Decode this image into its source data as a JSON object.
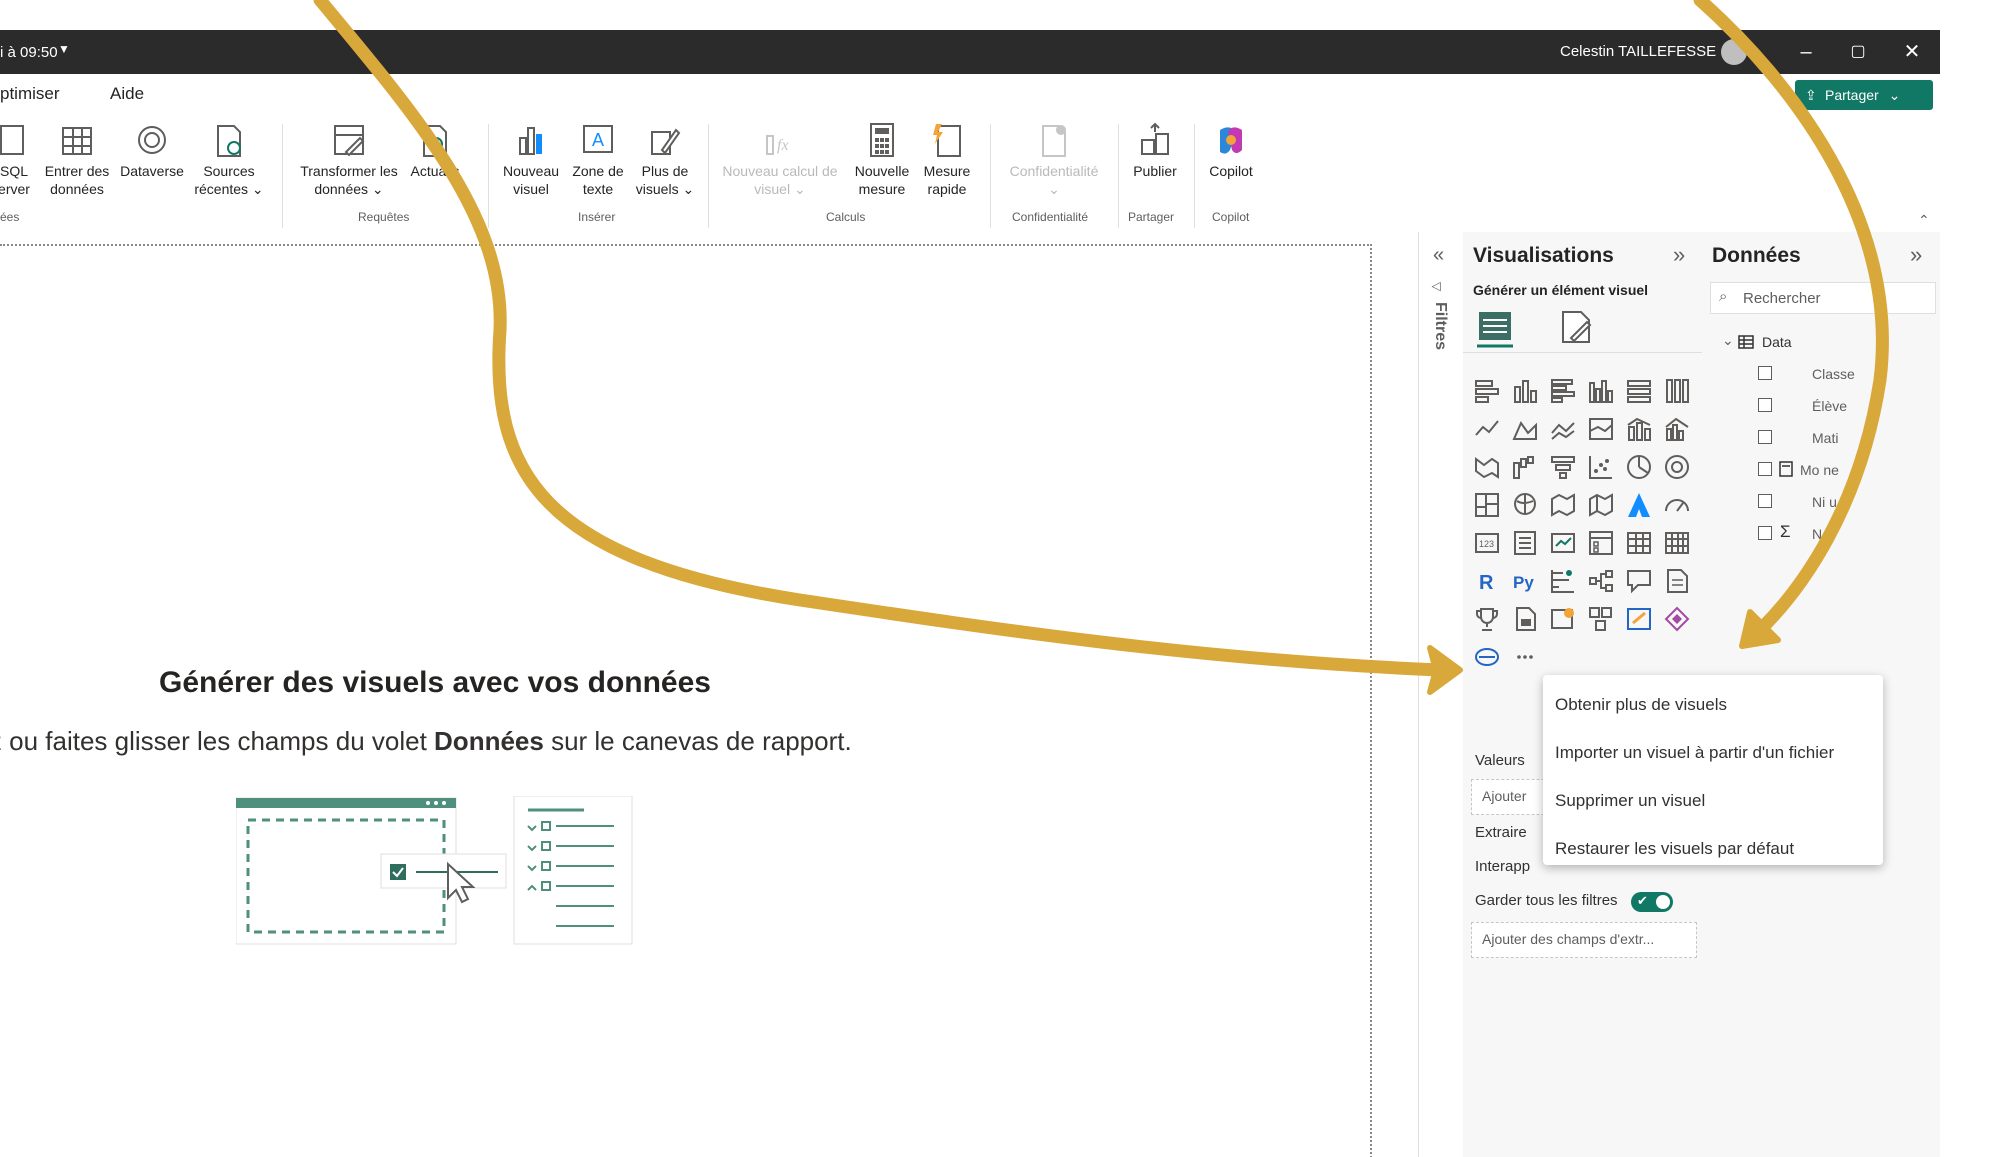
{
  "titlebar": {
    "left_text": "i à 09:50",
    "user_name": "Celestin TAILLEFESSE",
    "minimize": "–",
    "restore": "▢",
    "close": "✕"
  },
  "menubar": {
    "items": [
      "ptimiser",
      "Aide"
    ],
    "share_label": "Partager"
  },
  "ribbon": {
    "buttons": [
      {
        "line1": "SQL",
        "line2": "erver"
      },
      {
        "line1": "Entrer des",
        "line2": "données"
      },
      {
        "line1": "Dataverse",
        "line2": ""
      },
      {
        "line1": "Sources",
        "line2": "récentes ⌄"
      },
      {
        "line1": "Transformer les",
        "line2": "données ⌄"
      },
      {
        "line1": "Actualis",
        "line2": ""
      },
      {
        "line1": "Nouveau",
        "line2": "visuel"
      },
      {
        "line1": "Zone de",
        "line2": "texte"
      },
      {
        "line1": "Plus de",
        "line2": "visuels ⌄"
      },
      {
        "line1": "Nouveau calcul de",
        "line2": "visuel ⌄"
      },
      {
        "line1": "Nouvelle",
        "line2": "mesure"
      },
      {
        "line1": "Mesure",
        "line2": "rapide"
      },
      {
        "line1": "Confidentialité",
        "line2": "⌄"
      },
      {
        "line1": "Publier",
        "line2": ""
      },
      {
        "line1": "Copilot",
        "line2": ""
      }
    ],
    "groups": [
      "ées",
      "Requêtes",
      "Insérer",
      "Calculs",
      "Confidentialité",
      "Partager",
      "Copilot"
    ]
  },
  "canvas": {
    "title": "Générer des visuels avec vos données",
    "subtitle_pre": "nez ou faites glisser les champs du volet ",
    "subtitle_bold": "Données",
    "subtitle_post": " sur le canevas de rapport."
  },
  "filters": {
    "label": "Filtres"
  },
  "visualizations": {
    "title": "Visualisations",
    "subtitle": "Générer un élément visuel",
    "wells": {
      "values_label": "Valeurs",
      "add_placeholder": "Ajouter",
      "extract_label": "Extraire",
      "interact_label": "Interapp",
      "keep_filters_label": "Garder tous les filtres",
      "drill_placeholder": "Ajouter des champs d'extr..."
    }
  },
  "data_pane": {
    "title": "Données",
    "search_placeholder": "Rechercher",
    "table_name": "Data",
    "fields": [
      "Classe",
      "Élève",
      "Mati",
      "Mo     ne",
      "Ni    u",
      "N"
    ]
  },
  "context_menu": {
    "items": [
      "Obtenir plus de visuels",
      "Importer un visuel à partir d'un fichier",
      "Supprimer un visuel",
      "Restaurer les visuels par défaut"
    ]
  },
  "colors": {
    "accent": "#117865",
    "arrow": "#d9a83a",
    "titlebar": "#2b2b2b"
  }
}
